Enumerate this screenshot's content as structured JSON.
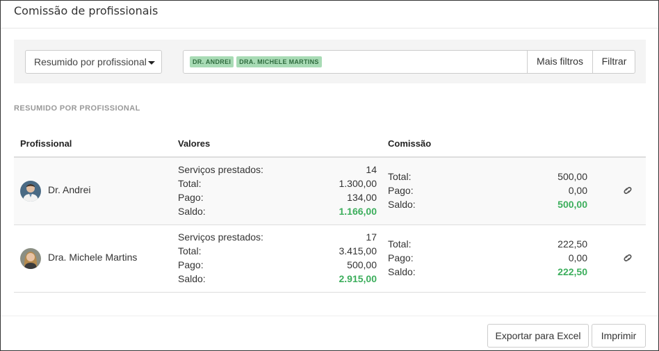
{
  "header": {
    "title": "Comissão de profissionais"
  },
  "filters": {
    "view_select": "Resumido por profissional",
    "tags": [
      "DR. ANDREI",
      "DRA. MICHELE MARTINS"
    ],
    "more_filters_label": "Mais filtros",
    "filter_label": "Filtrar"
  },
  "section_label": "RESUMIDO POR PROFISSIONAL",
  "table": {
    "columns": {
      "professional": "Profissional",
      "values": "Valores",
      "commission": "Comissão"
    },
    "labels": {
      "services": "Serviços prestados:",
      "total": "Total:",
      "paid": "Pago:",
      "balance": "Saldo:"
    },
    "rows": [
      {
        "name": "Dr. Andrei",
        "services": "14",
        "total": "1.300,00",
        "paid": "134,00",
        "balance": "1.166,00",
        "commission_total": "500,00",
        "commission_paid": "0,00",
        "commission_balance": "500,00"
      },
      {
        "name": "Dra. Michele Martins",
        "services": "17",
        "total": "3.415,00",
        "paid": "500,00",
        "balance": "2.915,00",
        "commission_total": "222,50",
        "commission_paid": "0,00",
        "commission_balance": "222,50"
      }
    ]
  },
  "footer": {
    "export_label": "Exportar para Excel",
    "print_label": "Imprimir"
  },
  "colors": {
    "accent_green": "#3cae5c",
    "tag_bg": "#a8dbb5"
  }
}
